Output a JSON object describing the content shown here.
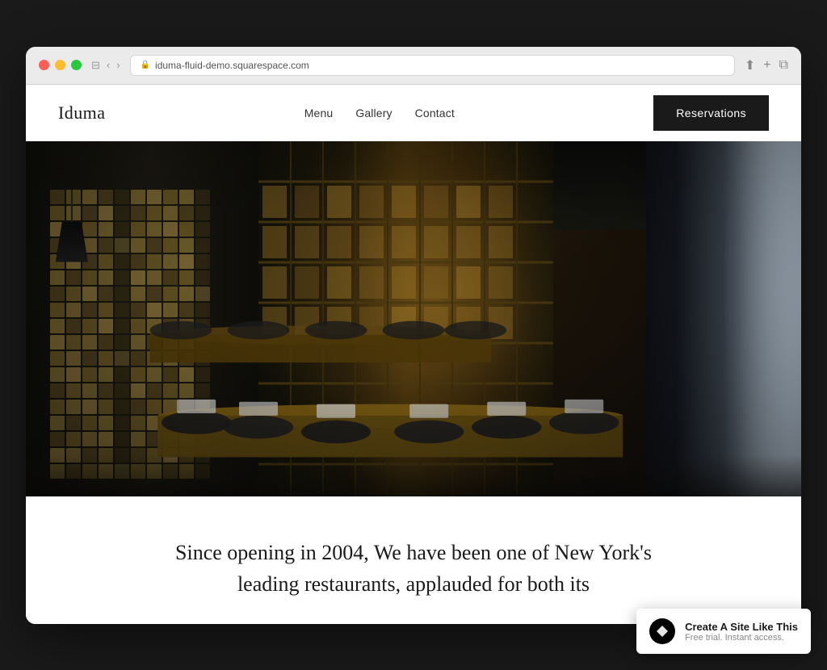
{
  "browser": {
    "url": "iduma-fluid-demo.squarespace.com",
    "back_label": "‹",
    "forward_label": "›",
    "window_controls": {
      "close": "close",
      "minimize": "minimize",
      "maximize": "maximize"
    }
  },
  "site": {
    "logo": "Iduma",
    "nav": {
      "items": [
        {
          "label": "Menu",
          "href": "#"
        },
        {
          "label": "Gallery",
          "href": "#"
        },
        {
          "label": "Contact",
          "href": "#"
        }
      ]
    },
    "cta_button": "Reservations"
  },
  "hero": {
    "alt": "Restaurant interior with wine rack shelving and dining tables"
  },
  "intro": {
    "text": "Since opening in 2004, We have been one of New York's leading restaurants, applauded for both its"
  },
  "squarespace_banner": {
    "title": "Create A Site Like This",
    "subtitle": "Free trial. Instant access.",
    "logo_char": "◼"
  }
}
